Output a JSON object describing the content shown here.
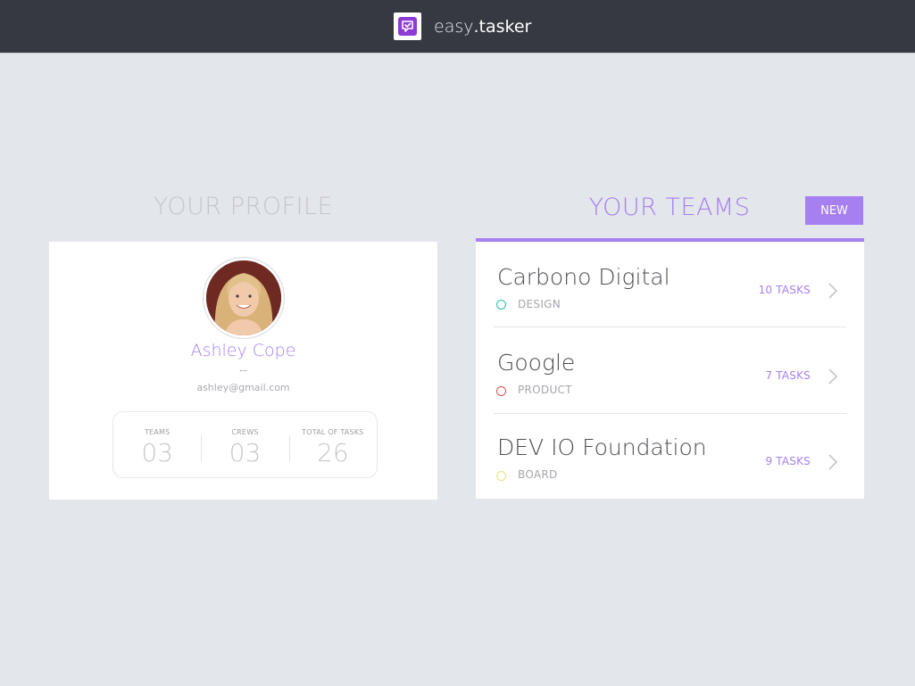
{
  "brand": {
    "name_part1": "easy",
    "name_part2": ".tasker",
    "logo_icon": "check-bubble-icon",
    "logo_color": "#8e3ad6"
  },
  "colors": {
    "accent": "#a67ff0",
    "topbar": "#363941",
    "background": "#e3e6eb"
  },
  "profile": {
    "section_title": "YOUR PROFILE",
    "name": "Ashley Cope",
    "subtitle": "--",
    "email": "ashley@gmail.com",
    "stats": [
      {
        "label": "TEAMS",
        "value": "03"
      },
      {
        "label": "CREWS",
        "value": "03"
      },
      {
        "label": "TOTAL OF TASKS",
        "value": "26"
      }
    ]
  },
  "teams": {
    "section_title": "YOUR TEAMS",
    "new_button": "NEW",
    "items": [
      {
        "name": "Carbono Digital",
        "category": "DESIGN",
        "tasks": "10 TASKS",
        "dot_color": "#1fbfb0"
      },
      {
        "name": "Google",
        "category": "PRODUCT",
        "tasks": "7 TASKS",
        "dot_color": "#e0504a"
      },
      {
        "name": "DEV IO Foundation",
        "category": "BOARD",
        "tasks": "9 TASKS",
        "dot_color": "#e8e27a"
      }
    ]
  }
}
